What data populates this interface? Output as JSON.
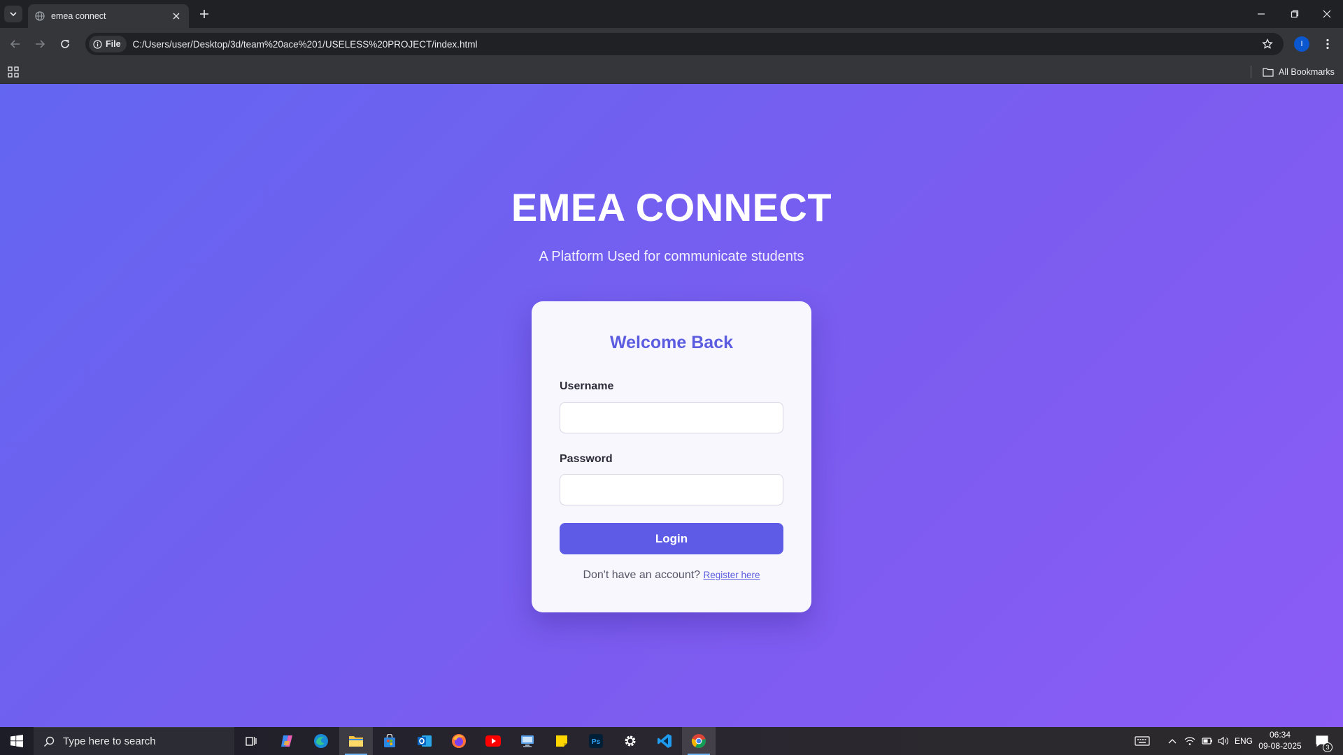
{
  "browser": {
    "tab": {
      "title": "emea connect"
    },
    "address_bar": {
      "chip_label": "File",
      "url": "C:/Users/user/Desktop/3d/team%20ace%201/USELESS%20PROJECT/index.html"
    },
    "profile_initial": "I",
    "bookmarks": {
      "all_bookmarks_label": "All Bookmarks"
    }
  },
  "page": {
    "title": "EMEA CONNECT",
    "subtitle": "A Platform Used for communicate students",
    "login": {
      "heading": "Welcome Back",
      "username_label": "Username",
      "username_value": "",
      "password_label": "Password",
      "password_value": "",
      "button_label": "Login",
      "register_prompt": "Don't have an account?",
      "register_link": "Register here"
    },
    "colors": {
      "gradient_start": "#6366f1",
      "gradient_end": "#8b5cf6",
      "accent": "#5e5ce6",
      "card_background": "#f8f7fd"
    }
  },
  "taskbar": {
    "search_placeholder": "Type here to search",
    "pinned_apps": [
      "task-view",
      "copilot",
      "edge",
      "file-explorer",
      "microsoft-store",
      "outlook",
      "firefox",
      "youtube",
      "remote-desktop",
      "sticky-notes",
      "photoshop",
      "settings",
      "vscode",
      "chrome"
    ],
    "tray": {
      "language": "ENG"
    },
    "clock": {
      "time": "06:34",
      "date": "09-08-2025"
    },
    "notification_count": "3"
  }
}
